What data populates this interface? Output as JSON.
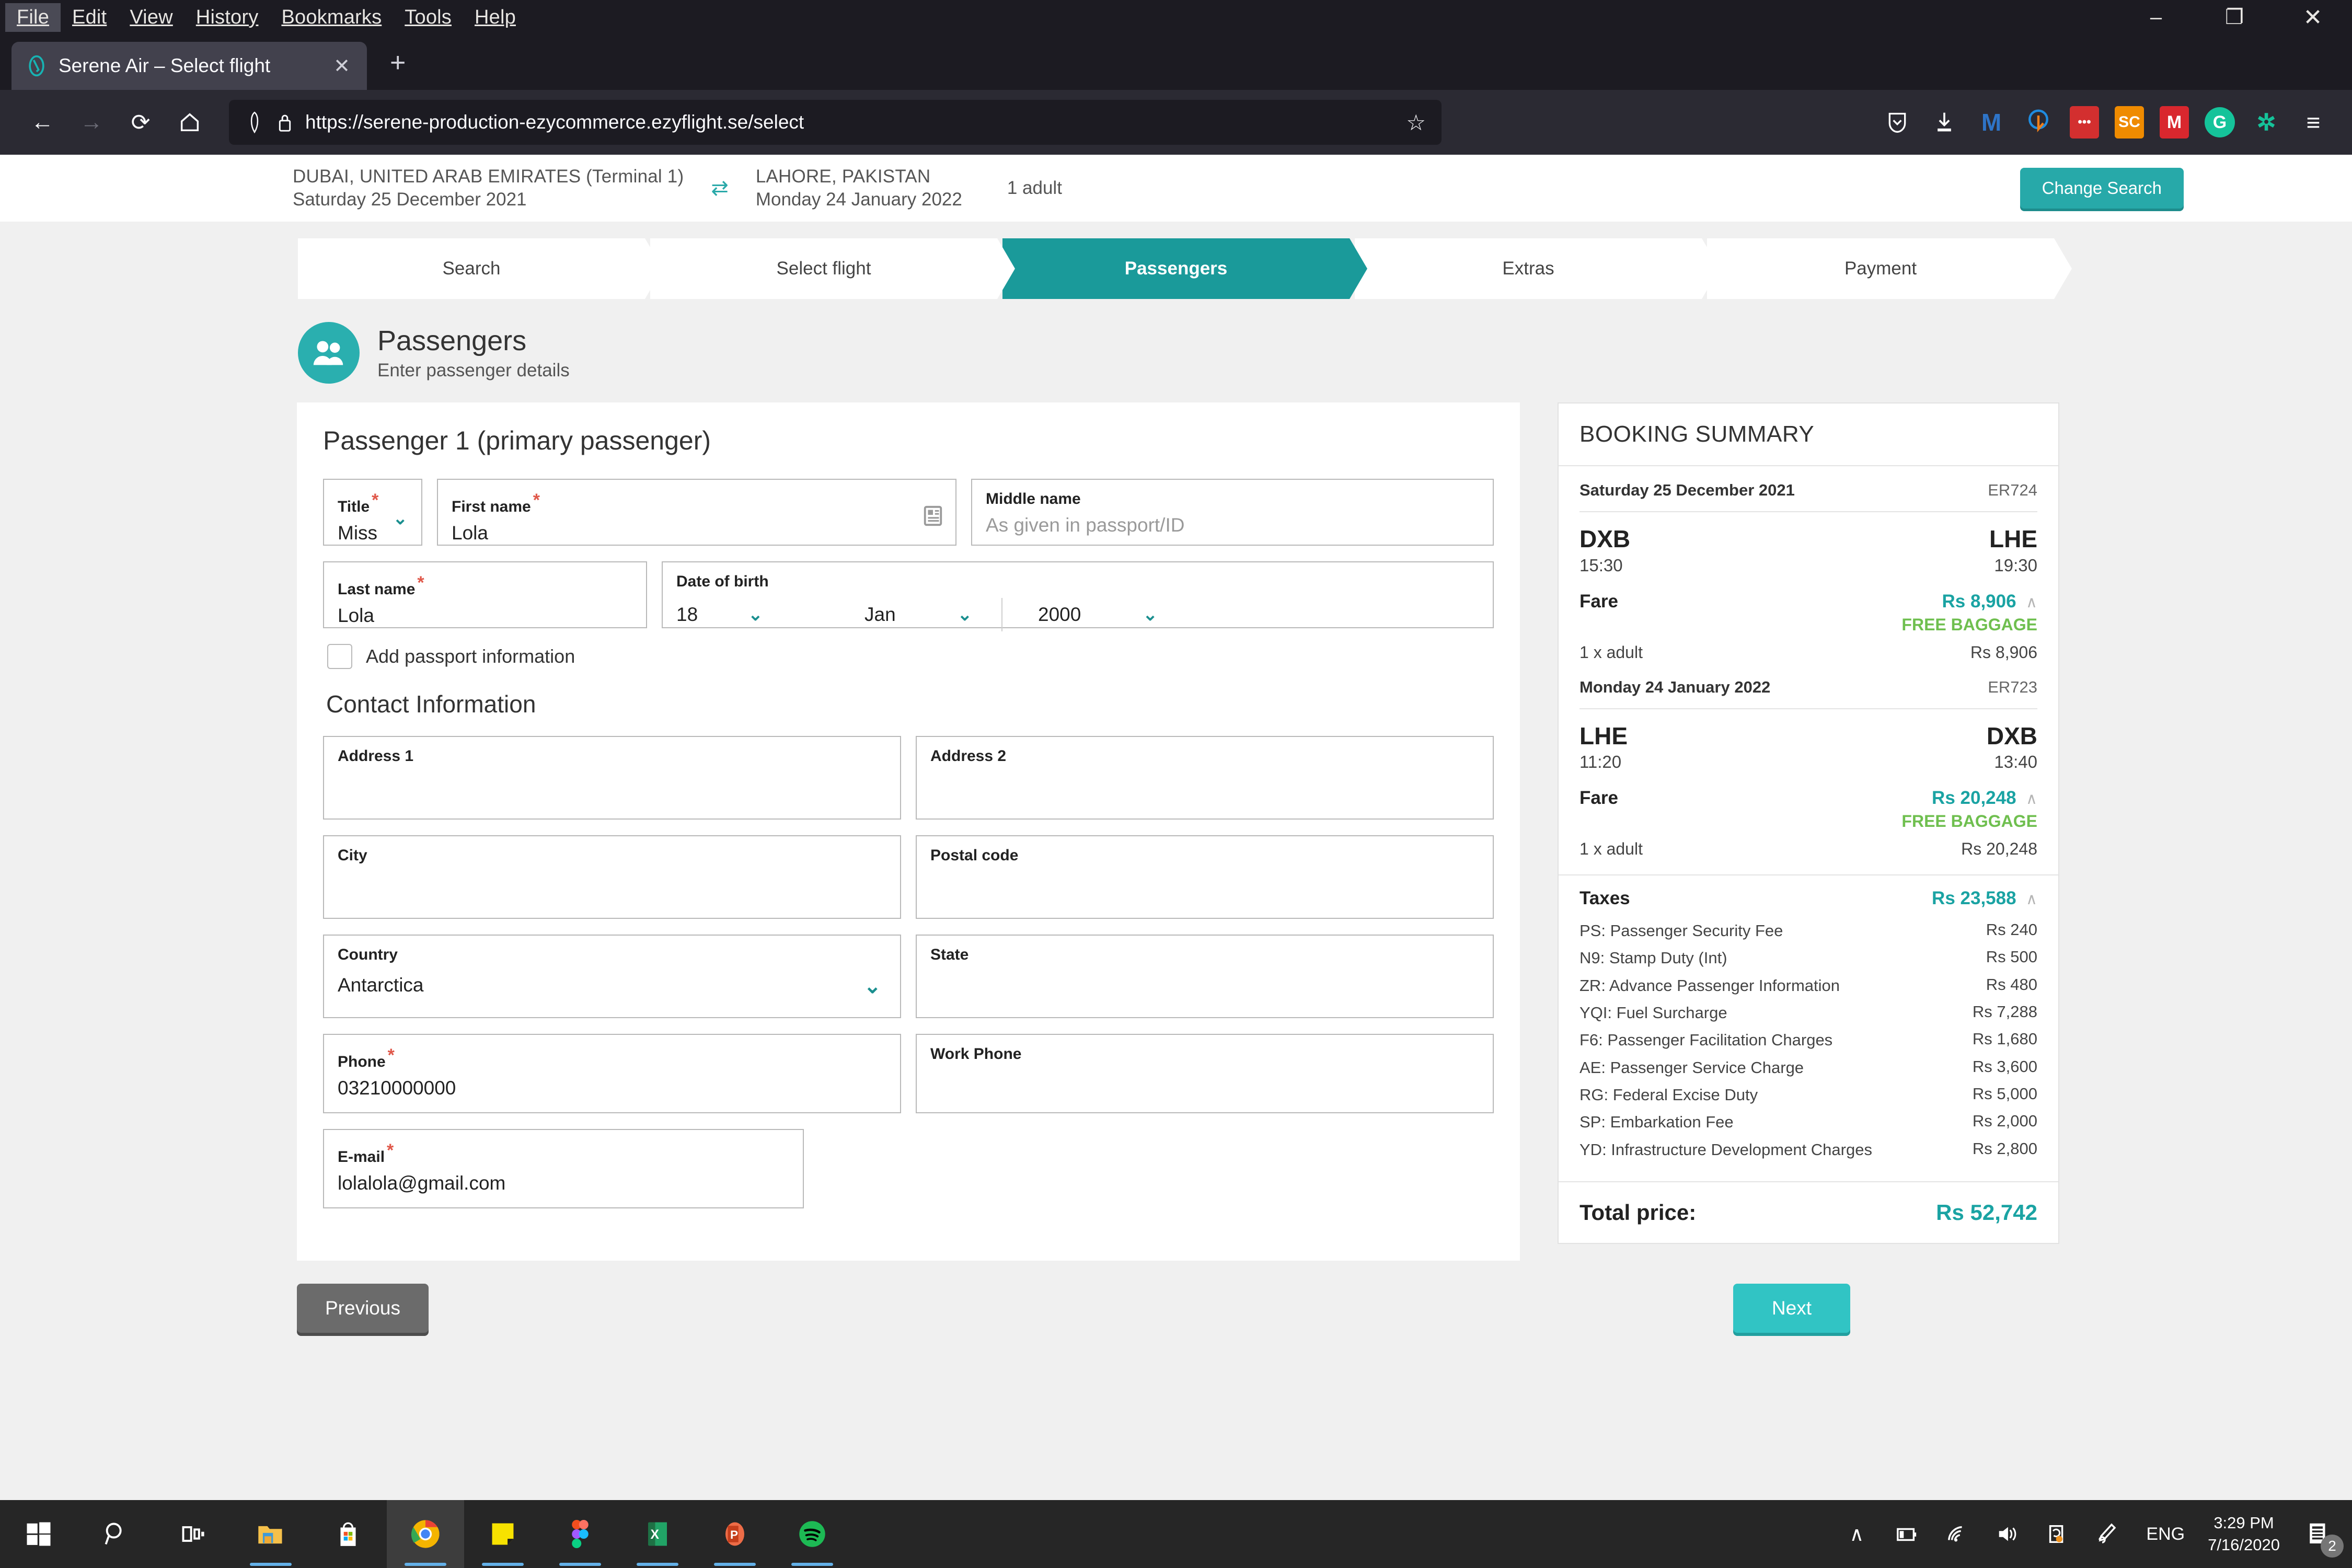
{
  "browser": {
    "menus": [
      "File",
      "Edit",
      "View",
      "History",
      "Bookmarks",
      "Tools",
      "Help"
    ],
    "window_controls": {
      "minimize": "–",
      "maximize": "❐",
      "close": "✕"
    },
    "tab": {
      "title": "Serene Air – Select flight",
      "close": "✕",
      "favicon": "serene-air-logo-icon"
    },
    "new_tab": "+",
    "nav": {
      "back": "←",
      "forward": "→",
      "reload": "⟳",
      "home": "⌂"
    },
    "url": "https://serene-production-ezycommerce.ezyflight.se/select",
    "url_shield": "⭔",
    "url_lock": "🔒",
    "bookmark_star": "☆",
    "extensions": [
      {
        "name": "pocket-icon",
        "glyph": "▽",
        "bg": "transparent",
        "fg": "#ffffff"
      },
      {
        "name": "downloads-icon",
        "glyph": "⬇",
        "bg": "transparent",
        "fg": "#ffffff"
      },
      {
        "name": "malwarebytes-icon",
        "glyph": "M",
        "bg": "transparent",
        "fg": "#2e74c8"
      },
      {
        "name": "avast-icon",
        "glyph": "◌",
        "bg": "transparent",
        "fg": "#ef7f1a"
      },
      {
        "name": "lastpass-icon",
        "glyph": "•••",
        "bg": "#d32f2f",
        "fg": "#ffffff"
      },
      {
        "name": "sc-extension-icon",
        "glyph": "SC",
        "bg": "#ef8b00",
        "fg": "#ffffff"
      },
      {
        "name": "mega-icon",
        "glyph": "M",
        "bg": "#d9272e",
        "fg": "#ffffff"
      },
      {
        "name": "grammarly-icon",
        "glyph": "G",
        "bg": "#15c39a",
        "fg": "#ffffff"
      },
      {
        "name": "ghostery-icon",
        "glyph": "Ѧ",
        "bg": "transparent",
        "fg": "#15c39a"
      },
      {
        "name": "app-menu-icon",
        "glyph": "≡",
        "bg": "transparent",
        "fg": "#ffffff"
      }
    ]
  },
  "site": {
    "trip": {
      "origin": "DUBAI, UNITED ARAB EMIRATES (Terminal 1)",
      "origin_date": "Saturday 25 December 2021",
      "swap_icon": "⇄",
      "destination": "LAHORE, PAKISTAN",
      "destination_date": "Monday 24 January 2022",
      "passengers": "1 adult"
    },
    "change_search": "Change Search",
    "steps": [
      "Search",
      "Select flight",
      "Passengers",
      "Extras",
      "Payment"
    ],
    "active_step": "Passengers",
    "page_title": "Passengers",
    "page_subtitle": "Enter passenger details",
    "page_icon": "passengers-icon"
  },
  "form": {
    "heading": "Passenger 1 (primary passenger)",
    "required_mark": "*",
    "title": {
      "label": "Title",
      "value": "Miss",
      "required": true
    },
    "first_name": {
      "label": "First name",
      "value": "Lola",
      "required": true
    },
    "middle_name": {
      "label": "Middle name",
      "value": "",
      "placeholder": "As given in passport/ID",
      "required": false
    },
    "last_name": {
      "label": "Last name",
      "value": "Lola",
      "required": true
    },
    "dob": {
      "label": "Date of birth",
      "day": "18",
      "month": "Jan",
      "year": "2000"
    },
    "passport_checkbox": {
      "label": "Add passport information",
      "checked": false
    },
    "contact_heading": "Contact Information",
    "address1": {
      "label": "Address 1",
      "value": ""
    },
    "address2": {
      "label": "Address 2",
      "value": ""
    },
    "city": {
      "label": "City",
      "value": ""
    },
    "postal_code": {
      "label": "Postal code",
      "value": ""
    },
    "country": {
      "label": "Country",
      "value": "Antarctica"
    },
    "state": {
      "label": "State",
      "value": ""
    },
    "phone": {
      "label": "Phone",
      "value": "03210000000",
      "required": true
    },
    "work_phone": {
      "label": "Work Phone",
      "value": ""
    },
    "email": {
      "label": "E-mail",
      "value": "lolalola@gmail.com",
      "required": true
    },
    "caret_icon": "⌄"
  },
  "summary": {
    "heading": "BOOKING SUMMARY",
    "legs": [
      {
        "date": "Saturday 25 December 2021",
        "flight_no": "ER724",
        "from_code": "DXB",
        "from_time": "15:30",
        "to_code": "LHE",
        "to_time": "19:30",
        "fare_label": "Fare",
        "fare_amount": "Rs 8,906",
        "baggage": "FREE BAGGAGE",
        "pax_label": "1 x adult",
        "pax_amount": "Rs 8,906"
      },
      {
        "date": "Monday 24 January 2022",
        "flight_no": "ER723",
        "from_code": "LHE",
        "from_time": "11:20",
        "to_code": "DXB",
        "to_time": "13:40",
        "fare_label": "Fare",
        "fare_amount": "Rs 20,248",
        "baggage": "FREE BAGGAGE",
        "pax_label": "1 x adult",
        "pax_amount": "Rs 20,248"
      }
    ],
    "taxes": {
      "label": "Taxes",
      "total": "Rs 23,588",
      "items": [
        {
          "name": "PS: Passenger Security Fee",
          "amount": "Rs 240"
        },
        {
          "name": "N9: Stamp Duty (Int)",
          "amount": "Rs 500"
        },
        {
          "name": "ZR: Advance Passenger Information",
          "amount": "Rs 480"
        },
        {
          "name": "YQI: Fuel Surcharge",
          "amount": "Rs 7,288"
        },
        {
          "name": "F6: Passenger Facilitation Charges",
          "amount": "Rs 1,680"
        },
        {
          "name": "AE: Passenger Service Charge",
          "amount": "Rs 3,600"
        },
        {
          "name": "RG: Federal Excise Duty",
          "amount": "Rs 5,000"
        },
        {
          "name": "SP: Embarkation Fee",
          "amount": "Rs 2,000"
        },
        {
          "name": "YD: Infrastructure Development Charges",
          "amount": "Rs 2,800"
        }
      ]
    },
    "total_label": "Total price:",
    "total_amount": "Rs 52,742",
    "collapse_icon": "∧"
  },
  "actions": {
    "previous": "Previous",
    "next": "Next"
  },
  "taskbar": {
    "items": [
      {
        "name": "start-button",
        "glyph": "⊞",
        "active": false,
        "running": false
      },
      {
        "name": "search-icon",
        "glyph": "⌕",
        "active": false,
        "running": false
      },
      {
        "name": "task-view-icon",
        "glyph": "▤",
        "active": false,
        "running": false
      },
      {
        "name": "file-explorer-icon",
        "glyph": "🗀",
        "active": false,
        "running": true
      },
      {
        "name": "microsoft-store-icon",
        "glyph": "⊞",
        "active": false,
        "running": false
      },
      {
        "name": "chrome-icon",
        "glyph": "◉",
        "active": true,
        "running": true
      },
      {
        "name": "sticky-notes-icon",
        "glyph": "◨",
        "active": false,
        "running": true
      },
      {
        "name": "figma-icon",
        "glyph": "⬤",
        "active": false,
        "running": true
      },
      {
        "name": "excel-icon",
        "glyph": "X",
        "active": false,
        "running": true
      },
      {
        "name": "powerpoint-icon",
        "glyph": "P",
        "active": false,
        "running": true
      },
      {
        "name": "spotify-icon",
        "glyph": "♫",
        "active": false,
        "running": true
      }
    ],
    "tray": [
      {
        "name": "show-hidden-icons",
        "glyph": "∧"
      },
      {
        "name": "battery-icon",
        "glyph": "▭"
      },
      {
        "name": "wifi-icon",
        "glyph": "◠"
      },
      {
        "name": "volume-icon",
        "glyph": "🔊"
      },
      {
        "name": "onedrive-icon",
        "glyph": "❐"
      },
      {
        "name": "pen-icon",
        "glyph": "✎"
      }
    ],
    "language": "ENG",
    "time": "3:29 PM",
    "date": "7/16/2020",
    "notifications_count": "2",
    "notifications_icon": "notification-center-icon"
  },
  "colors": {
    "brand_teal": "#27a9a9",
    "step_active": "#1a9a9a",
    "fare_teal": "#1aa3a3",
    "baggage_green": "#6fbf4f",
    "required_red": "#e0584a",
    "next_button": "#31c4c4"
  }
}
